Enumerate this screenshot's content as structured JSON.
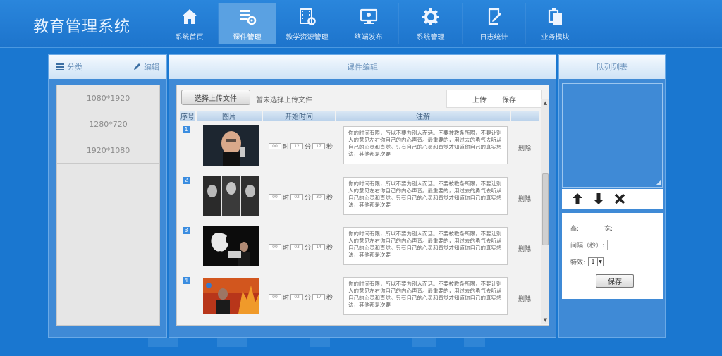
{
  "app": {
    "title": "教育管理系统"
  },
  "nav": [
    {
      "label": "系统首页",
      "icon": "home-icon"
    },
    {
      "label": "课件管理",
      "icon": "courseware-settings-icon",
      "active": true
    },
    {
      "label": "教学资源管理",
      "icon": "film-settings-icon"
    },
    {
      "label": "终端发布",
      "icon": "monitor-publish-icon"
    },
    {
      "label": "系统管理",
      "icon": "gear-icon"
    },
    {
      "label": "日志统计",
      "icon": "log-edit-icon"
    },
    {
      "label": "业务模块",
      "icon": "module-copy-icon"
    }
  ],
  "left_panel": {
    "category_label": "分类",
    "edit_label": "编辑",
    "resolutions": [
      "1080*1920",
      "1280*720",
      "1920*1080"
    ]
  },
  "center_panel": {
    "title": "课件编辑",
    "upload_button": "选择上传文件",
    "upload_status": "暂未选择上传文件",
    "tabs": [
      "上传",
      "保存"
    ],
    "columns": [
      "序号",
      "图片",
      "开始时间",
      "注解"
    ],
    "rows": [
      {
        "index": "1",
        "hour": "00",
        "minute": "12",
        "second": "17",
        "h_unit": "时",
        "m_unit": "分",
        "s_unit": "秒",
        "note": "你的时间有限，所以不要为别人而活。不要被教条所限，不要让别人的意见左右你自己的内心声音。最重要的，用过去的勇气去听从自己的心灵和直觉。只有自己的心灵和直觉才知道你自己的真实想法，其他都是次要",
        "delete": "删除"
      },
      {
        "index": "2",
        "hour": "00",
        "minute": "02",
        "second": "30",
        "h_unit": "时",
        "m_unit": "分",
        "s_unit": "秒",
        "note": "你的时间有限，所以不要为别人而活。不要被教条所限，不要让别人的意见左右你自己的内心声音。最重要的，用过去的勇气去听从自己的心灵和直觉。只有自己的心灵和直觉才知道你自己的真实想法，其他都是次要",
        "delete": "删除"
      },
      {
        "index": "3",
        "hour": "00",
        "minute": "03",
        "second": "14",
        "h_unit": "时",
        "m_unit": "分",
        "s_unit": "秒",
        "note": "你的时间有限，所以不要为别人而活。不要被教条所限，不要让别人的意见左右你自己的内心声音。最重要的，用过去的勇气去听从自己的心灵和直觉。只有自己的心灵和直觉才知道你自己的真实想法，其他都是次要",
        "delete": "删除"
      },
      {
        "index": "4",
        "hour": "00",
        "minute": "02",
        "second": "17",
        "h_unit": "时",
        "m_unit": "分",
        "s_unit": "秒",
        "note": "你的时间有限，所以不要为别人而活。不要被教条所限，不要让别人的意见左右你自己的内心声音。最重要的，用过去的勇气去听从自己的心灵和直觉。只有自己的心灵和直觉才知道你自己的真实想法，其他都是次要",
        "delete": "删除"
      }
    ]
  },
  "right_panel": {
    "title": "队列列表",
    "height_label": "高:",
    "width_label": "宽:",
    "interval_label": "间隔（秒）:",
    "effect_label": "特效:",
    "effect_value": "1",
    "save_button": "保存"
  },
  "colors": {
    "background": "#1a77d0",
    "nav_active": "#5aa1e2",
    "badge": "#3b8de0"
  }
}
